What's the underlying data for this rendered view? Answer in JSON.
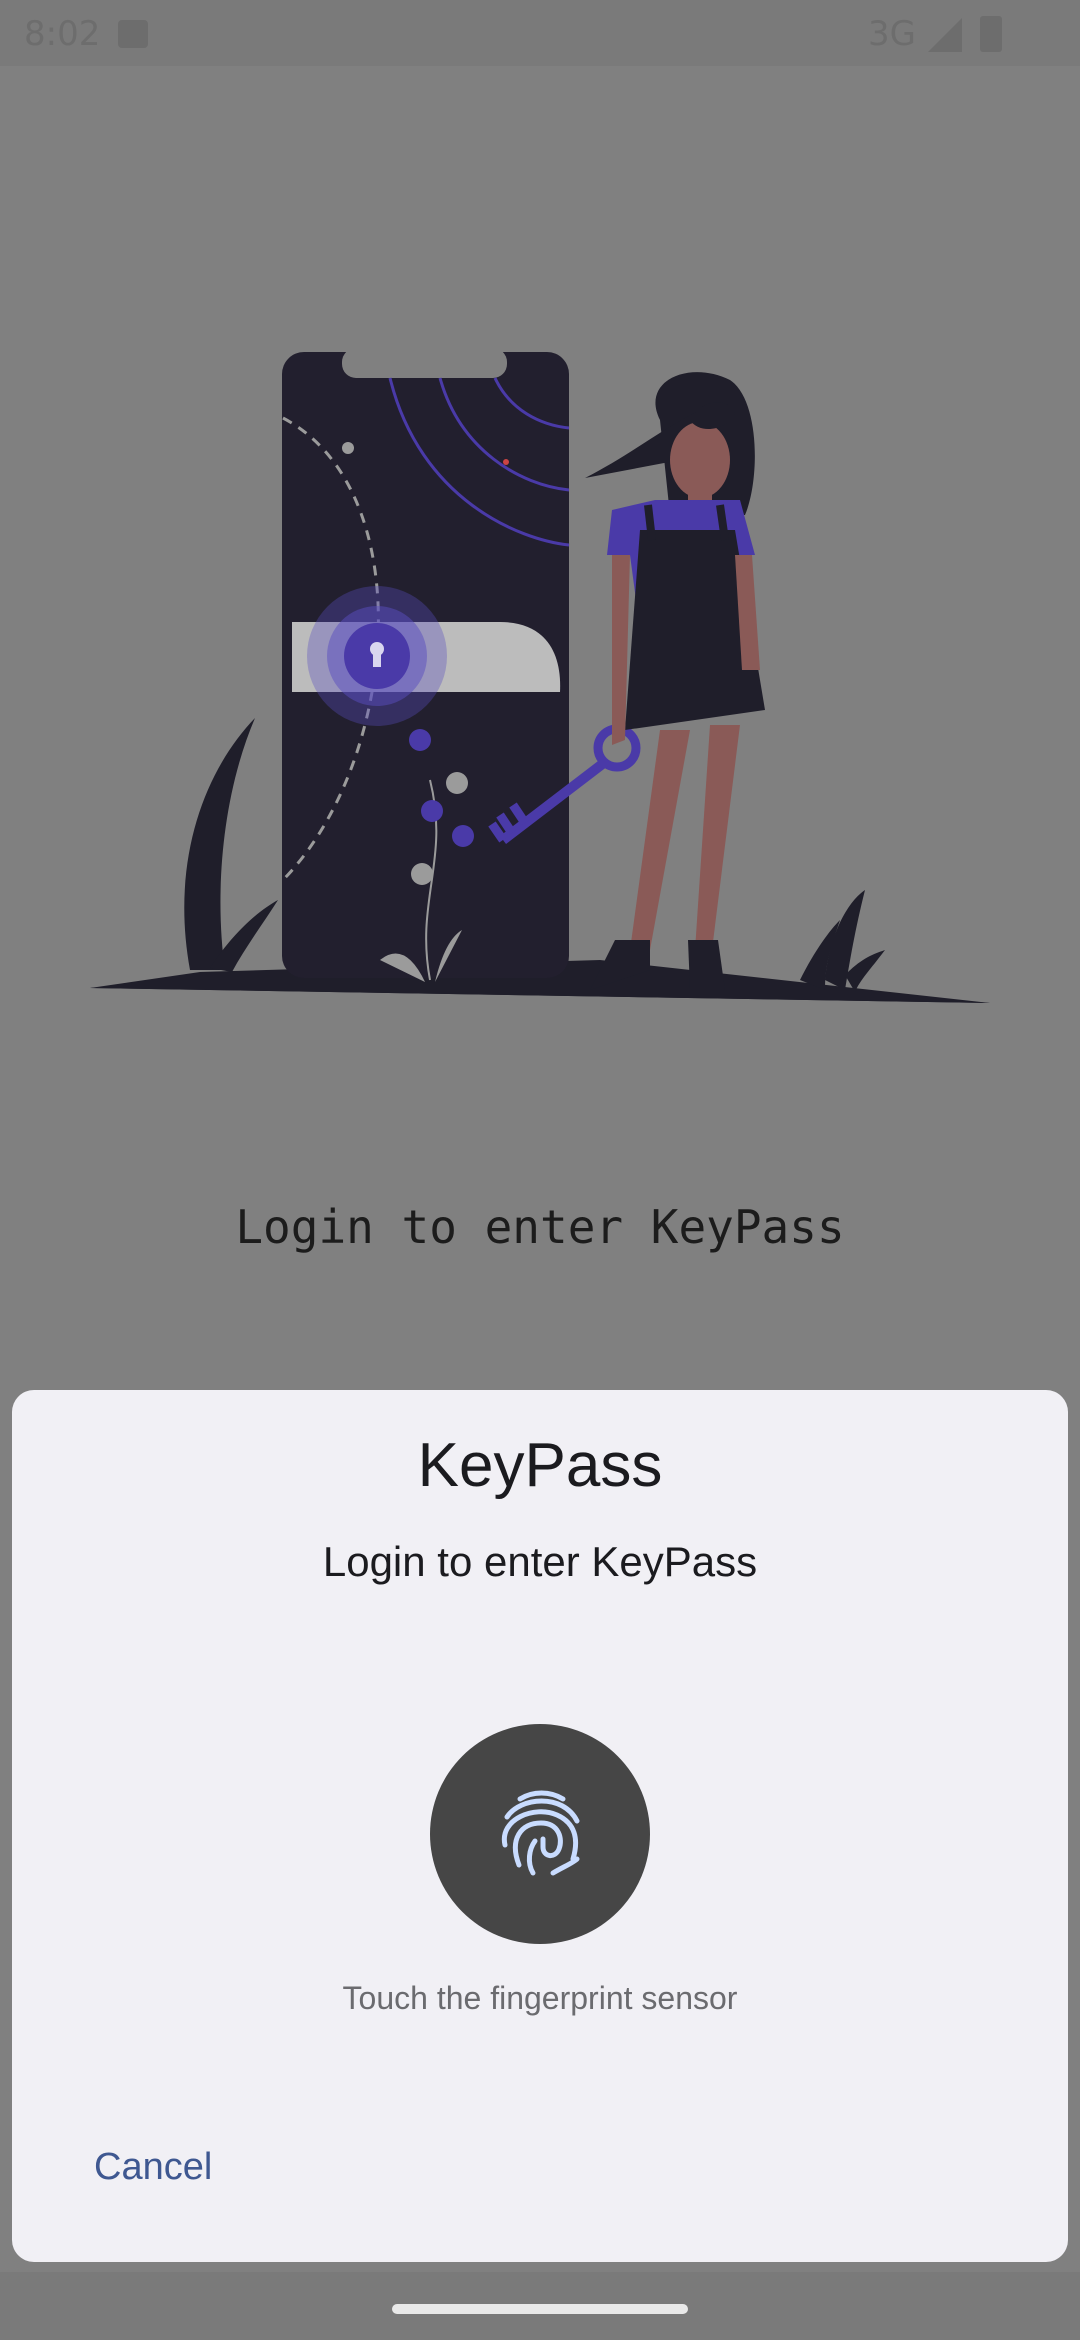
{
  "status_bar": {
    "time": "8:02",
    "network": "3G",
    "icons": [
      "image-icon",
      "signal-icon",
      "battery-icon"
    ]
  },
  "illustration": {
    "description_icon": "phone-lock-key-illustration"
  },
  "main": {
    "heading": "Login to enter KeyPass"
  },
  "dialog": {
    "title": "KeyPass",
    "subtitle": "Login to enter KeyPass",
    "fingerprint_icon": "fingerprint-icon",
    "hint": "Touch the fingerprint sensor",
    "cancel_label": "Cancel"
  },
  "colors": {
    "scrim": "#808080",
    "sheet": "#f1f0f5",
    "accent_purple": "#4a3aa8",
    "fingerprint_bg": "#464646",
    "fingerprint_stroke": "#c9dcff",
    "cancel_text": "#3f5891"
  }
}
